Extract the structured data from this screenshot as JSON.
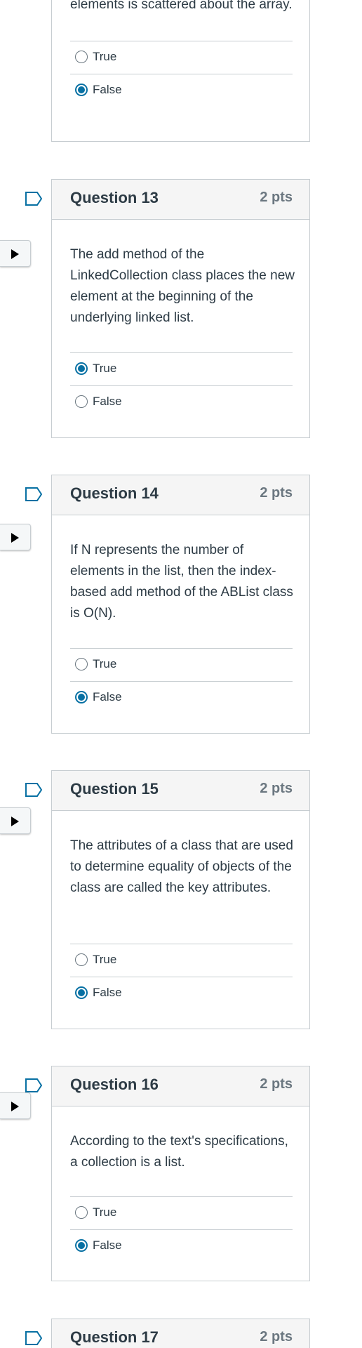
{
  "partial": {
    "text": "elements is scattered about the array.",
    "answers": [
      {
        "label": "True",
        "selected": false
      },
      {
        "label": "False",
        "selected": true
      }
    ]
  },
  "questions": [
    {
      "title": "Question 13",
      "points": "2 pts",
      "text": "The add method of the LinkedCollection class places the new element at the beginning of the underlying linked list.",
      "answers": [
        {
          "label": "True",
          "selected": true
        },
        {
          "label": "False",
          "selected": false
        }
      ]
    },
    {
      "title": "Question 14",
      "points": "2 pts",
      "text": "If N represents the number of elements in the list, then the index-based add method of the ABList class is O(N).",
      "answers": [
        {
          "label": "True",
          "selected": false
        },
        {
          "label": "False",
          "selected": true
        }
      ]
    },
    {
      "title": "Question 15",
      "points": "2 pts",
      "text": "The attributes of a class that are used to determine equality of objects of the class are called the key attributes.",
      "answers": [
        {
          "label": "True",
          "selected": false
        },
        {
          "label": "False",
          "selected": true
        }
      ]
    },
    {
      "title": "Question 16",
      "points": "2 pts",
      "text": "According to the text's specifications, a collection is a list.",
      "answers": [
        {
          "label": "True",
          "selected": false
        },
        {
          "label": "False",
          "selected": true
        }
      ]
    },
    {
      "title": "Question 17",
      "points": "2 pts"
    }
  ],
  "icons": {
    "flag": "flag-outline-icon",
    "toggle": "caret-right-icon"
  },
  "colors": {
    "accent": "#0770a3",
    "flag": "#0770a3",
    "header_bg": "#f5f5f5",
    "border": "#c7cdd1",
    "text": "#2d3b45",
    "points": "#6b7780"
  }
}
